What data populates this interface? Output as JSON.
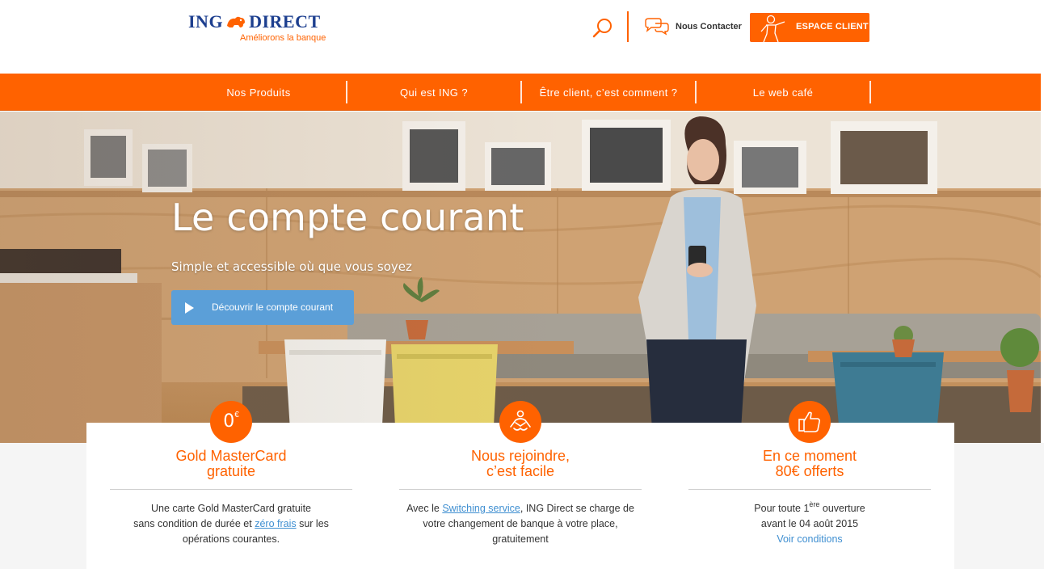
{
  "brand": {
    "name_left": "ING",
    "name_right": "DIRECT",
    "tagline": "Améliorons la banque",
    "primary_color": "#ff6200",
    "logo_blue": "#1d3f8f",
    "link_color": "#3f8fd1"
  },
  "header": {
    "search_icon": "search-icon",
    "contact_label": "Nous Contacter",
    "espace_client_label": "ESPACE CLIENT"
  },
  "nav": {
    "items": [
      {
        "label": "Nos Produits"
      },
      {
        "label": "Qui est ING ?"
      },
      {
        "label": "Être client, c’est comment ?"
      },
      {
        "label": "Le web café"
      }
    ]
  },
  "hero": {
    "title": "Le compte courant",
    "subtitle": "Simple et accessible où que vous soyez",
    "cta_label": "Découvrir le compte courant",
    "cta_color": "#5b9fd8"
  },
  "cards": [
    {
      "icon": "zero-euro-icon",
      "icon_text": "0",
      "icon_sup": "€",
      "title_line1": "Gold MasterCard",
      "title_line2": "gratuite",
      "body_line1": "Une carte Gold MasterCard gratuite",
      "body_line2_pre": "sans condition de durée et ",
      "body_line2_link": "zéro frais",
      "body_line2_post": " sur les",
      "body_line3": "opérations courantes."
    },
    {
      "icon": "handshake-icon",
      "title_line1": "Nous rejoindre,",
      "title_line2": "c’est facile",
      "body_line1_pre": "Avec le ",
      "body_line1_link": "Switching service",
      "body_line1_post": ", ING Direct se charge de",
      "body_line2": "votre changement de banque à votre place,",
      "body_line3": "gratuitement"
    },
    {
      "icon": "thumbs-up-icon",
      "title_line1": "En ce moment",
      "title_line2": "80€ offerts",
      "body_line1_pre": "Pour toute 1",
      "body_line1_sup": "ère",
      "body_line1_post": " ouverture",
      "body_line2": "avant le 04 août 2015",
      "body_line3_link": "Voir conditions"
    }
  ]
}
